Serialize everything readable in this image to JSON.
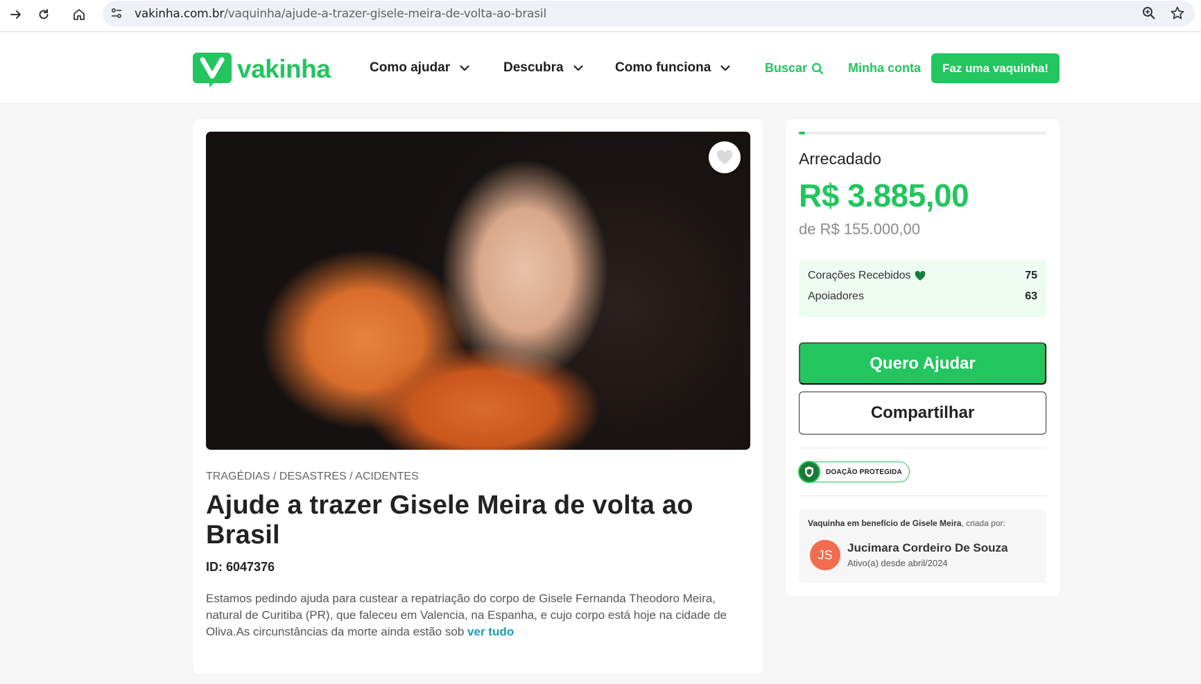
{
  "browser": {
    "url_host": "vakinha.com.br",
    "url_path": "/vaquinha/ajude-a-trazer-gisele-meira-de-volta-ao-brasil"
  },
  "header": {
    "logo_text": "vakinha",
    "menu": [
      {
        "label": "Como ajudar"
      },
      {
        "label": "Descubra"
      },
      {
        "label": "Como funciona"
      }
    ],
    "search_label": "Buscar",
    "account_label": "Minha conta",
    "cta_label": "Faz uma vaquinha!"
  },
  "campaign": {
    "category": "TRAGÉDIAS / DESASTRES / ACIDENTES",
    "title": "Ajude a trazer Gisele Meira de volta ao Brasil",
    "id_text": "ID: 6047376",
    "description": "Estamos pedindo ajuda para custear a repatriação do corpo de Gisele Fernanda Theodoro Meira, natural de Curitiba (PR), que faleceu em Valencia, na Espanha, e cujo corpo está hoje na cidade de Oliva.As circunstâncias da morte ainda estão sob",
    "read_more": "ver tudo",
    "image_alt": "Foto de Gisele Meira sorrindo"
  },
  "sidebar": {
    "raised_label": "Arrecadado",
    "raised_amount": "R$ 3.885,00",
    "goal_text": "de R$ 155.000,00",
    "progress_fraction": 0.025,
    "stats": [
      {
        "label": "Corações Recebidos",
        "value": "75"
      },
      {
        "label": "Apoiadores",
        "value": "63"
      }
    ],
    "help_button": "Quero Ajudar",
    "share_button": "Compartilhar",
    "protected_badge": "DOAÇÃO PROTEGIDA",
    "creator_caption_bold": "Vaquinha em benefício de Gisele Meira",
    "creator_caption_rest": ", criada por:",
    "creator_initials": "JS",
    "creator_name": "Jucimara Cordeiro De Souza",
    "creator_since": "Ativo(a) desde abril/2024"
  },
  "colors": {
    "brand_green": "#22c55e",
    "link_teal": "#1a9bb5",
    "avatar": "#f26c4f"
  }
}
